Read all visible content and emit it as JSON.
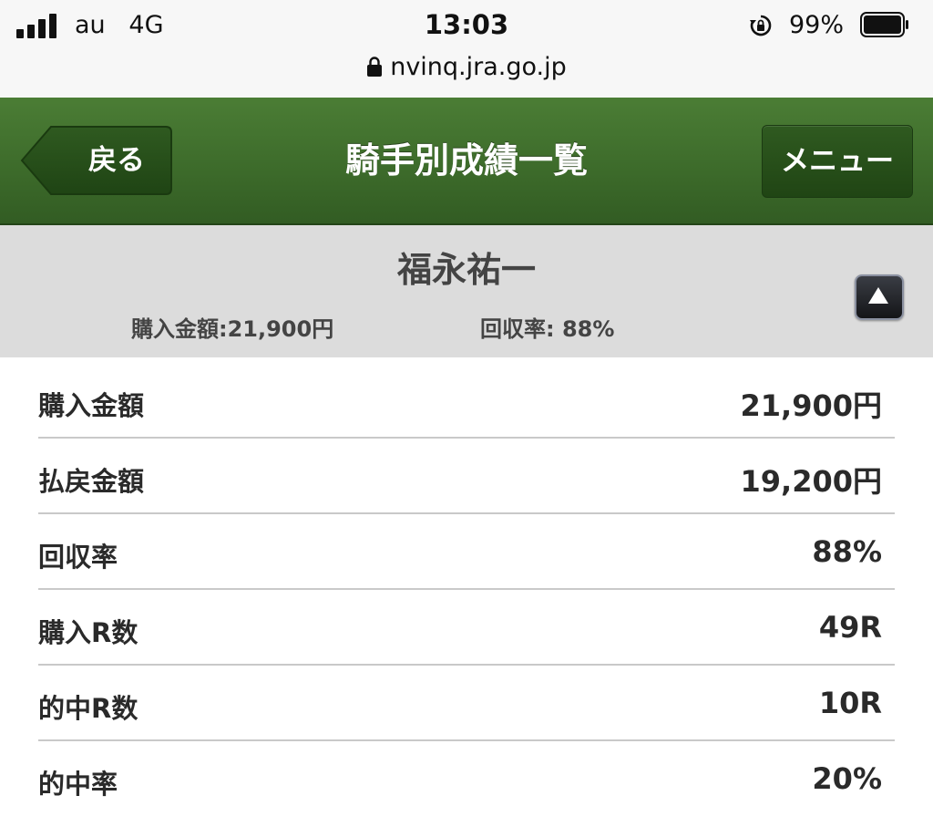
{
  "status_bar": {
    "carrier": "au",
    "network": "4G",
    "time": "13:03",
    "battery_percent": "99%",
    "url": "nvinq.jra.go.jp"
  },
  "header": {
    "back_label": "戻る",
    "title": "騎手別成績一覧",
    "menu_label": "メニュー",
    "colors": {
      "bar": "#3c6a2a",
      "button": "#204514"
    }
  },
  "jockey": {
    "name": "福永祐一",
    "summary_purchase": "購入金額:21,900円",
    "summary_recovery": "回収率: 88%"
  },
  "stats": [
    {
      "label": "購入金額",
      "value": "21,900円"
    },
    {
      "label": "払戻金額",
      "value": "19,200円"
    },
    {
      "label": "回収率",
      "value": "88%"
    },
    {
      "label": "購入R数",
      "value": "49R"
    },
    {
      "label": "的中R数",
      "value": "10R"
    },
    {
      "label": "的中率",
      "value": "20%"
    }
  ]
}
